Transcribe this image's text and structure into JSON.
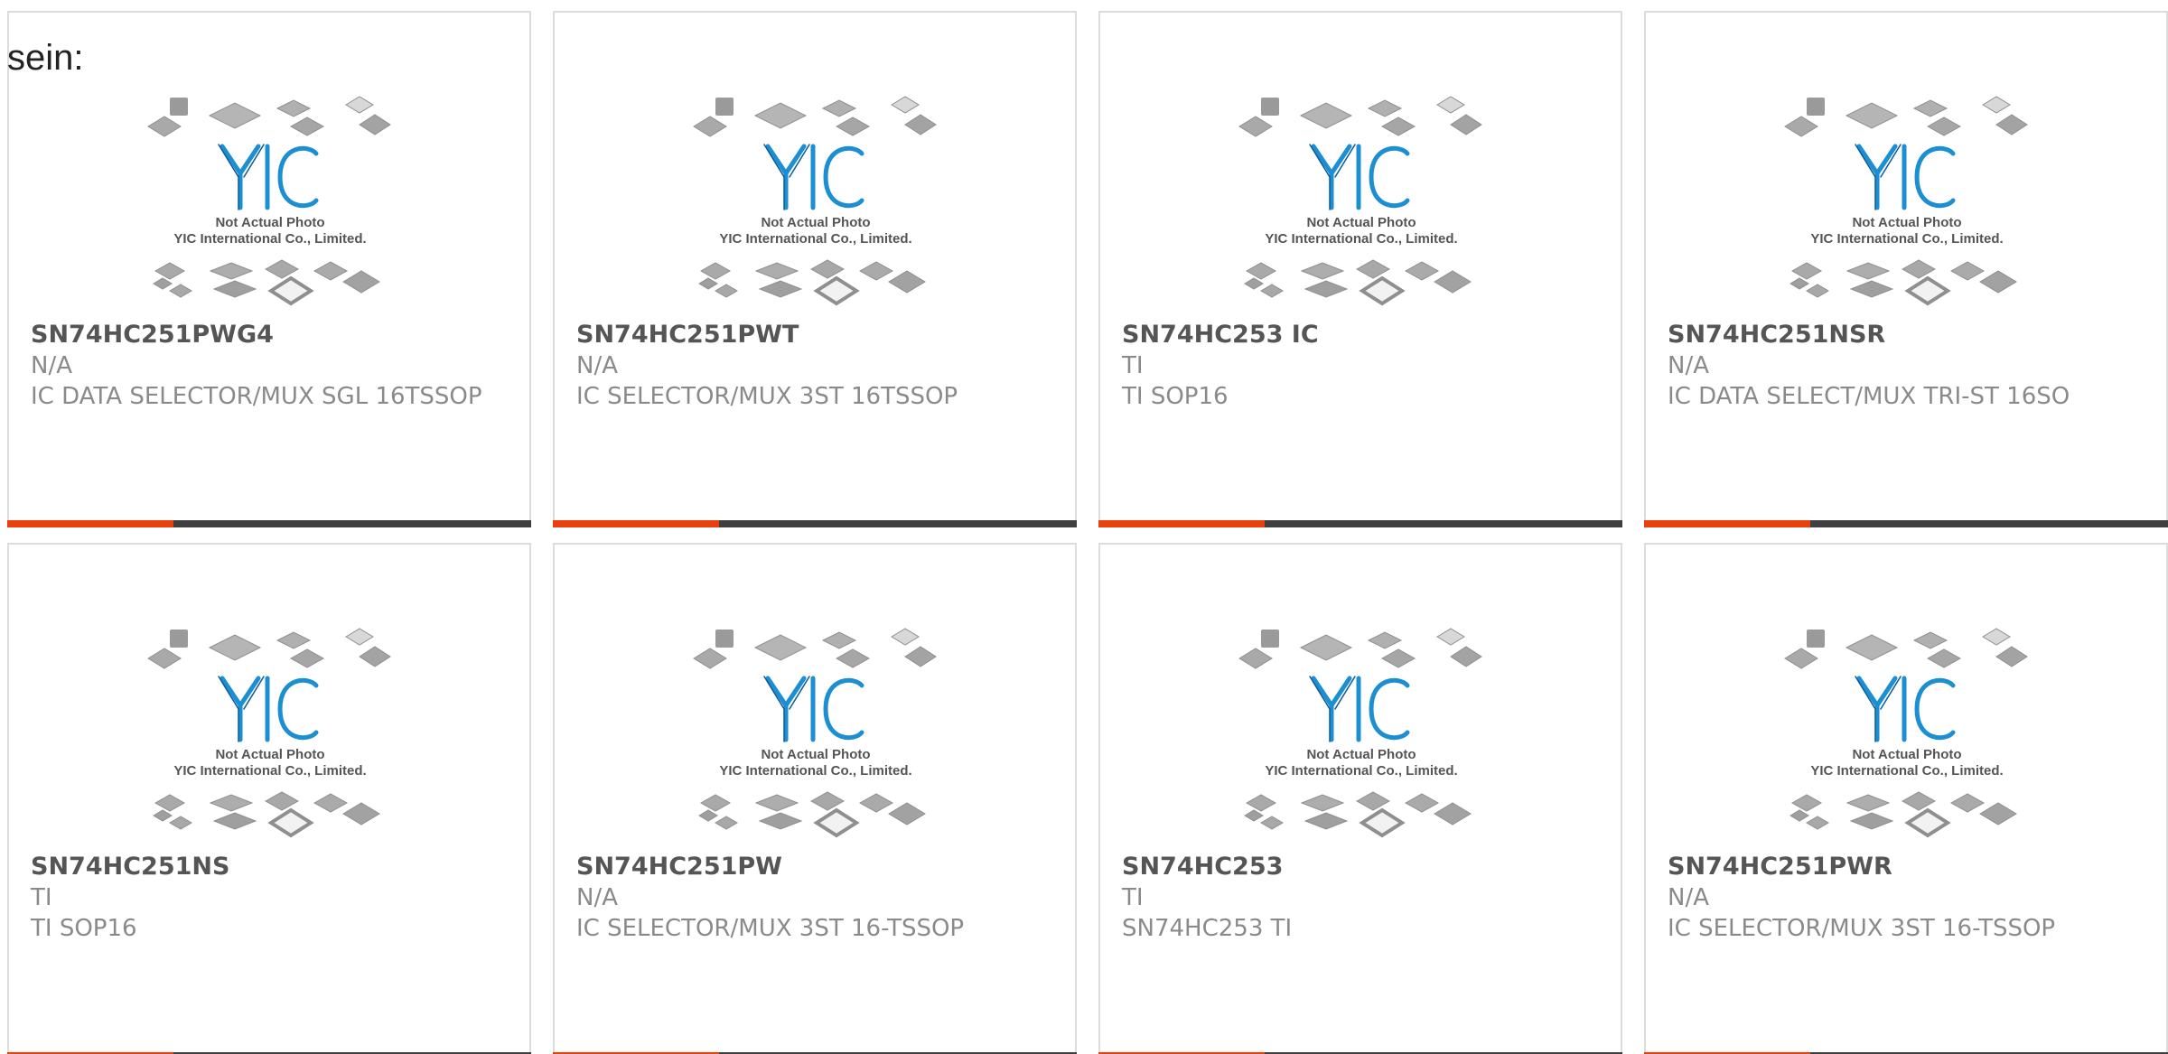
{
  "stray_label": "sein:",
  "image_caption": {
    "line1": "Not Actual Photo",
    "line2": "YIC International Co., Limited."
  },
  "colors": {
    "accent": "#e8410d",
    "bar": "#3f3f3f",
    "logo_blue": "#1b8fd1"
  },
  "products": [
    {
      "part": "SN74HC251PWG4",
      "maker": "N/A",
      "desc": "IC DATA SELECTOR/MUX SGL 16TSSOP"
    },
    {
      "part": "SN74HC251PWT",
      "maker": "N/A",
      "desc": "IC SELECTOR/MUX 3ST 16TSSOP"
    },
    {
      "part": "SN74HC253 IC",
      "maker": "TI",
      "desc": "TI SOP16"
    },
    {
      "part": "SN74HC251NSR",
      "maker": "N/A",
      "desc": "IC DATA SELECT/MUX TRI-ST 16SO"
    },
    {
      "part": "SN74HC251NS",
      "maker": "TI",
      "desc": "TI SOP16"
    },
    {
      "part": "SN74HC251PW",
      "maker": "N/A",
      "desc": "IC SELECTOR/MUX 3ST 16-TSSOP"
    },
    {
      "part": "SN74HC253",
      "maker": "TI",
      "desc": "SN74HC253 TI"
    },
    {
      "part": "SN74HC251PWR",
      "maker": "N/A",
      "desc": "IC SELECTOR/MUX 3ST 16-TSSOP"
    }
  ]
}
